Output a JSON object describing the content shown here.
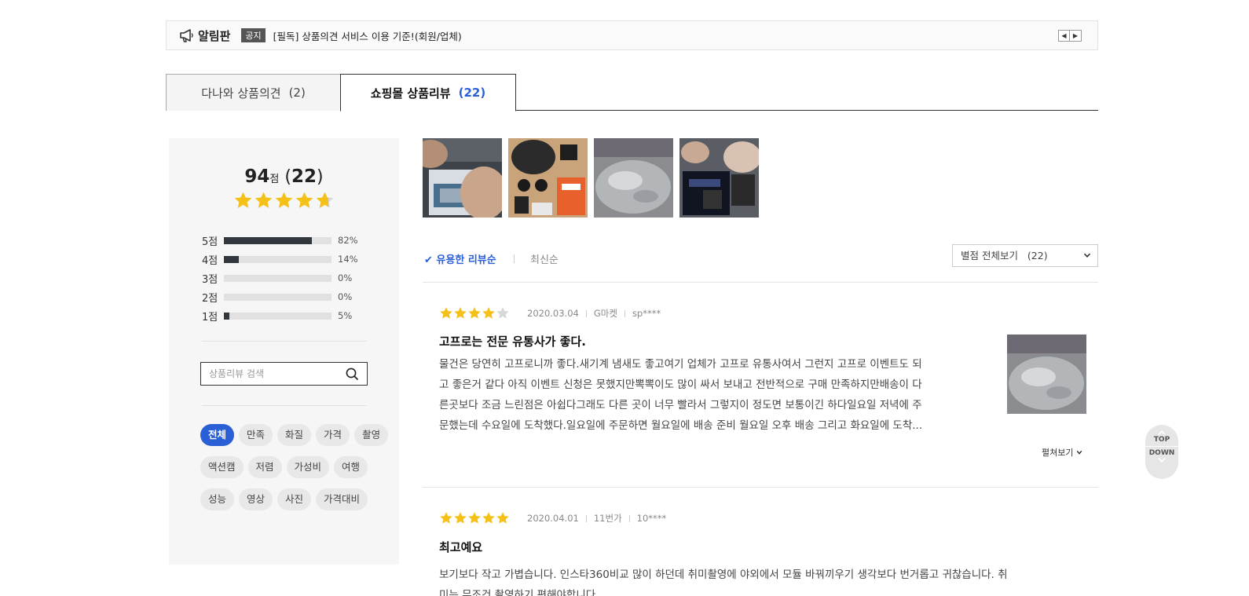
{
  "notice": {
    "title": "알림판",
    "badge": "공지",
    "text": "[필독] 상품의견 서비스 이용 기준!(회원/업체)",
    "prev_label": "◀",
    "next_label": "▶"
  },
  "tabs": [
    {
      "label": "다나와 상품의견",
      "count": "(2)"
    },
    {
      "label": "쇼핑몰 상품리뷰",
      "count": "(22)"
    }
  ],
  "summary": {
    "score": "94",
    "score_unit": "점",
    "count_open": " (",
    "count": "22",
    "count_close": ")",
    "rating": 4.7,
    "distribution": [
      {
        "label": "5점",
        "percent": 82,
        "percent_text": "82%"
      },
      {
        "label": "4점",
        "percent": 14,
        "percent_text": "14%"
      },
      {
        "label": "3점",
        "percent": 0,
        "percent_text": "0%"
      },
      {
        "label": "2점",
        "percent": 0,
        "percent_text": "0%"
      },
      {
        "label": "1점",
        "percent": 5,
        "percent_text": "5%"
      }
    ]
  },
  "search": {
    "placeholder": "상품리뷰 검색"
  },
  "keywords": [
    "전체",
    "만족",
    "화질",
    "가격",
    "촬영",
    "액션캠",
    "저렴",
    "가성비",
    "여행",
    "성능",
    "영상",
    "사진",
    "가격대비"
  ],
  "sort": {
    "helpful": "✔ 유용한 리뷰순",
    "latest": "최신순",
    "filter_label": "별점 전체보기",
    "filter_count": "(22)"
  },
  "reviews": [
    {
      "rating": 4,
      "date": "2020.03.04",
      "mall": "G마켓",
      "user": "sp****",
      "title": "고프로는 전문 유통사가 좋다.",
      "body": [
        "물건은 당연히 고프로니까 좋다.새기계 냄새도 좋고여기 업체가 고프로 유통사여서 그런지 고프로 이벤트도 되",
        "고 좋은거 같다 아직 이벤트 신청은 못했지만뽁뽁이도 많이 싸서 보내고 전반적으로 구매 만족하지만배송이 다",
        "른곳보다 조금 느린점은 아쉽다그래도 다른 곳이 너무 빨라서 그렇지이 정도면 보통이긴 하다일요일 저녁에 주",
        "문했는데 수요일에 도착했다.일요일에 주문하면 월요일에 배송 준비 월요일 오후 배송 그리고 화요일에 도착..."
      ],
      "expand": "펼쳐보기"
    },
    {
      "rating": 5,
      "date": "2020.04.01",
      "mall": "11번가",
      "user": "10****",
      "title": "최고예요",
      "body": [
        "보기보다 작고 가볍습니다. 인스타360비교 많이 하던데 취미촬영에 야외에서 모듈 바꿔끼우기 생각보다 번거롭고 귀찮습니다. 취",
        "미는 무조건 촬영하기 편해야합니다"
      ]
    }
  ],
  "scroll": {
    "top": "TOP",
    "down": "DOWN"
  },
  "colors": {
    "accent": "#2a5fd6",
    "star": "#f5c118",
    "star_empty": "#d8d8d8",
    "bar": "#32373d"
  }
}
